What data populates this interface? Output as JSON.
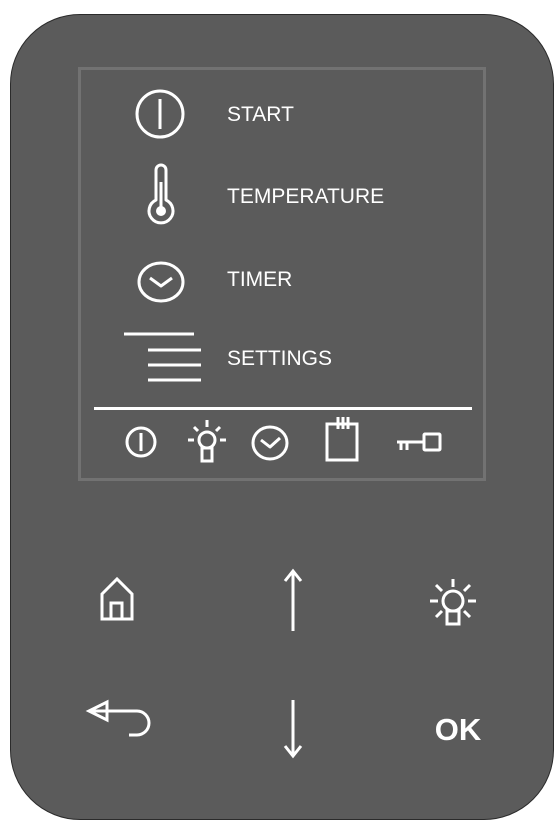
{
  "menu": {
    "items": [
      {
        "label": "START",
        "icon": "power-icon"
      },
      {
        "label": "TEMPERATURE",
        "icon": "thermometer-icon"
      },
      {
        "label": "TIMER",
        "icon": "clock-icon"
      },
      {
        "label": "SETTINGS",
        "icon": "settings-lines-icon"
      }
    ]
  },
  "status_bar": {
    "icons": [
      "power-status-icon",
      "light-status-icon",
      "timer-status-icon",
      "calendar-status-icon",
      "key-lock-status-icon"
    ]
  },
  "buttons": {
    "home": {
      "icon": "home-icon"
    },
    "up": {
      "icon": "arrow-up-icon"
    },
    "light": {
      "icon": "light-bulb-icon"
    },
    "back": {
      "icon": "back-arrow-icon"
    },
    "down": {
      "icon": "arrow-down-icon"
    },
    "ok": {
      "label": "OK"
    }
  },
  "colors": {
    "panel": "#5b5b5b",
    "screen_border": "#727272",
    "foreground": "#ffffff"
  }
}
